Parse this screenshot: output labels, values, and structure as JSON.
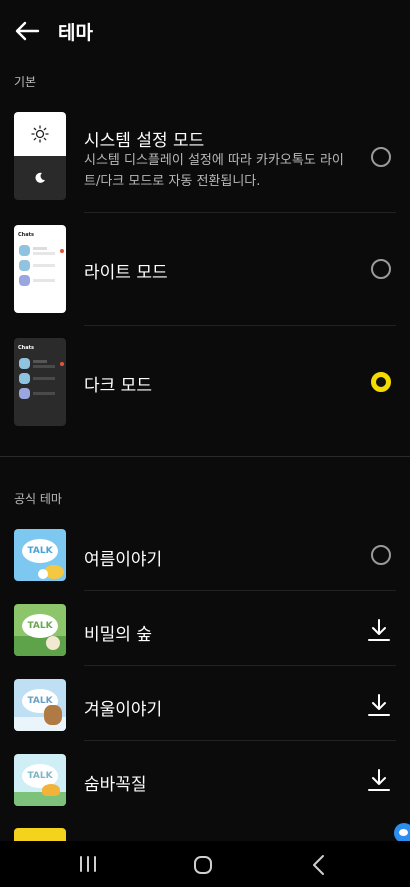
{
  "header": {
    "title": "테마",
    "back_icon": "arrow-left-icon"
  },
  "sections": {
    "basic_label": "기본",
    "official_label": "공식 테마"
  },
  "basic_themes": [
    {
      "title": "시스템 설정 모드",
      "description": "시스템 디스플레이 설정에 따라 카카오톡도 라이트/다크 모드로 자동 전환됩니다.",
      "selected": false
    },
    {
      "title": "라이트 모드",
      "preview_label": "Chats",
      "selected": false
    },
    {
      "title": "다크 모드",
      "preview_label": "Chats",
      "selected": true
    }
  ],
  "official_themes": [
    {
      "title": "여름이야기",
      "badge": "TALK",
      "action": "radio",
      "selected": false
    },
    {
      "title": "비밀의 숲",
      "badge": "TALK",
      "action": "download"
    },
    {
      "title": "겨울이야기",
      "badge": "TALK",
      "action": "download"
    },
    {
      "title": "숨바꼭질",
      "badge": "TALK",
      "action": "download"
    }
  ],
  "colors": {
    "accent": "#f5dc00",
    "background": "#0b0b0b"
  },
  "navbar": {
    "recent_icon": "recent-apps-icon",
    "home_icon": "home-icon",
    "back_icon": "nav-back-icon"
  }
}
